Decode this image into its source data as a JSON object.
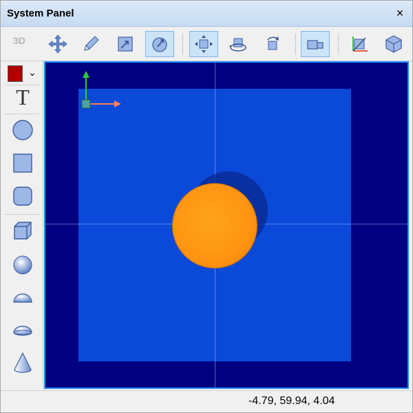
{
  "window": {
    "title": "System Panel",
    "close_glyph": "×"
  },
  "toolbar": {
    "mode_label": "3D",
    "tools": [
      {
        "icon": "move-arrows-icon",
        "active": false
      },
      {
        "icon": "pencil-icon",
        "active": false
      },
      {
        "icon": "scale-icon",
        "active": false
      },
      {
        "icon": "rotate-sphere-icon",
        "active": true
      },
      {
        "icon": "pan-view-icon",
        "active": true
      },
      {
        "icon": "orbit-icon",
        "active": false
      },
      {
        "icon": "rotate-view-icon",
        "active": false
      },
      {
        "icon": "camera-view-icon",
        "active": true
      },
      {
        "icon": "axes-icon",
        "active": false
      },
      {
        "icon": "cube-view-icon",
        "active": false
      }
    ]
  },
  "palette": {
    "color": "#b00000",
    "text_tool_label": "T",
    "tools": [
      "circle-icon",
      "square-icon",
      "rounded-square-icon",
      "cube-icon",
      "sphere-icon",
      "half-sphere-icon",
      "lens-icon",
      "cone-icon"
    ]
  },
  "viewport": {
    "background": "#000080",
    "plane_color": "#0b49d9",
    "sphere_color": "#ff9412",
    "gizmo_x_color": "#ff7f50",
    "gizmo_y_color": "#32cd32"
  },
  "status": {
    "coordinates": "-4.79, 59.94, 4.04"
  }
}
